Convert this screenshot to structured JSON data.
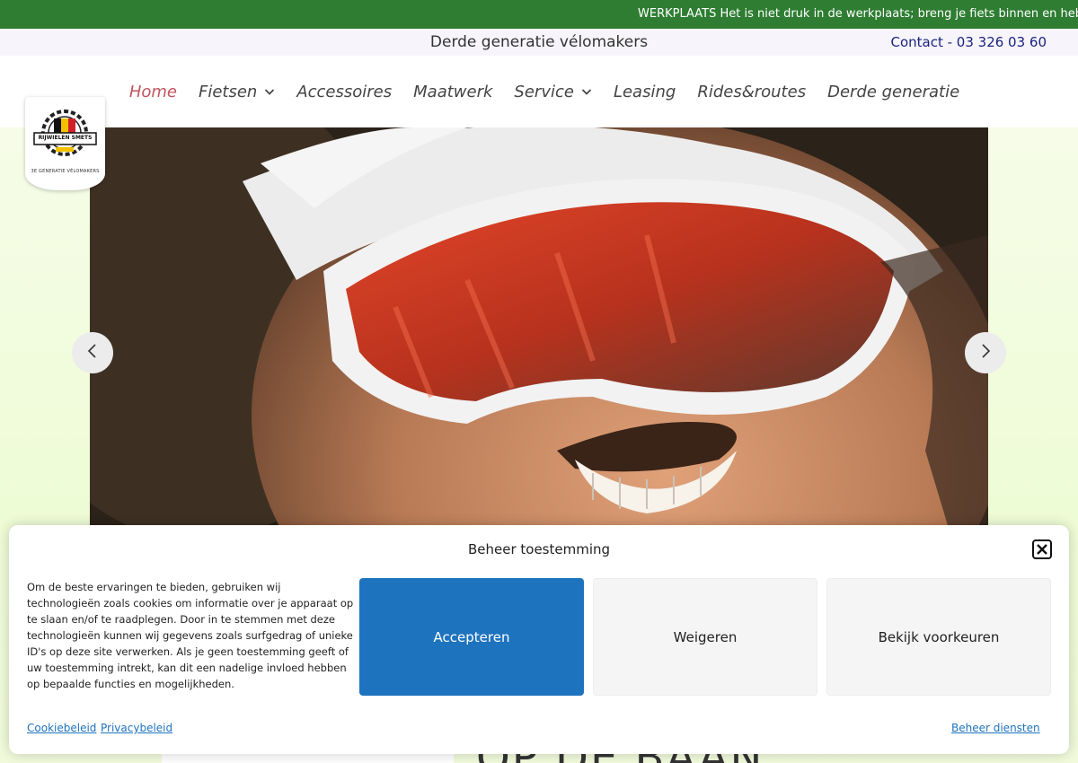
{
  "ticker": {
    "text": "WERKPLAATS Het is niet druk in de werkplaats; breng je fiets binnen en heb het"
  },
  "topbar": {
    "tagline": "Derde generatie vélomakers",
    "contact": "Contact - 03 326 03 60"
  },
  "nav": {
    "items": [
      {
        "label": "Home",
        "active": true
      },
      {
        "label": "Fietsen",
        "dropdown": true
      },
      {
        "label": "Accessoires"
      },
      {
        "label": "Maatwerk"
      },
      {
        "label": "Service",
        "dropdown": true
      },
      {
        "label": "Leasing"
      },
      {
        "label": "Rides&routes"
      },
      {
        "label": "Derde generatie"
      }
    ]
  },
  "logo": {
    "name": "RIJWIELEN SMETS",
    "subtitle": "3E GENERATIE VÉLOMAKERS"
  },
  "hero": {
    "icons": {
      "prev": "chevron-left-icon",
      "next": "chevron-right-icon"
    }
  },
  "peek": {
    "heading": "OP DE BAAN"
  },
  "consent": {
    "title": "Beheer toestemming",
    "message": "Om de beste ervaringen te bieden, gebruiken wij technologieën zoals cookies om informatie over je apparaat op te slaan en/of te raadplegen. Door in te stemmen met deze technologieën kunnen wij gegevens zoals surfgedrag of unieke ID's op deze site verwerken. Als je geen toestemming geeft of uw toestemming intrekt, kan dit een nadelige invloed hebben op bepaalde functies en mogelijkheden.",
    "accept_label": "Accepteren",
    "deny_label": "Weigeren",
    "prefs_label": "Bekijk voorkeuren",
    "cookie_policy": "Cookiebeleid",
    "privacy_policy": "Privacybeleid",
    "manage_services": "Beheer diensten"
  },
  "colors": {
    "ticker_bg": "#2e7d32",
    "accent": "#1e73be",
    "nav_active": "#c0555e",
    "contact": "#1a237e"
  }
}
